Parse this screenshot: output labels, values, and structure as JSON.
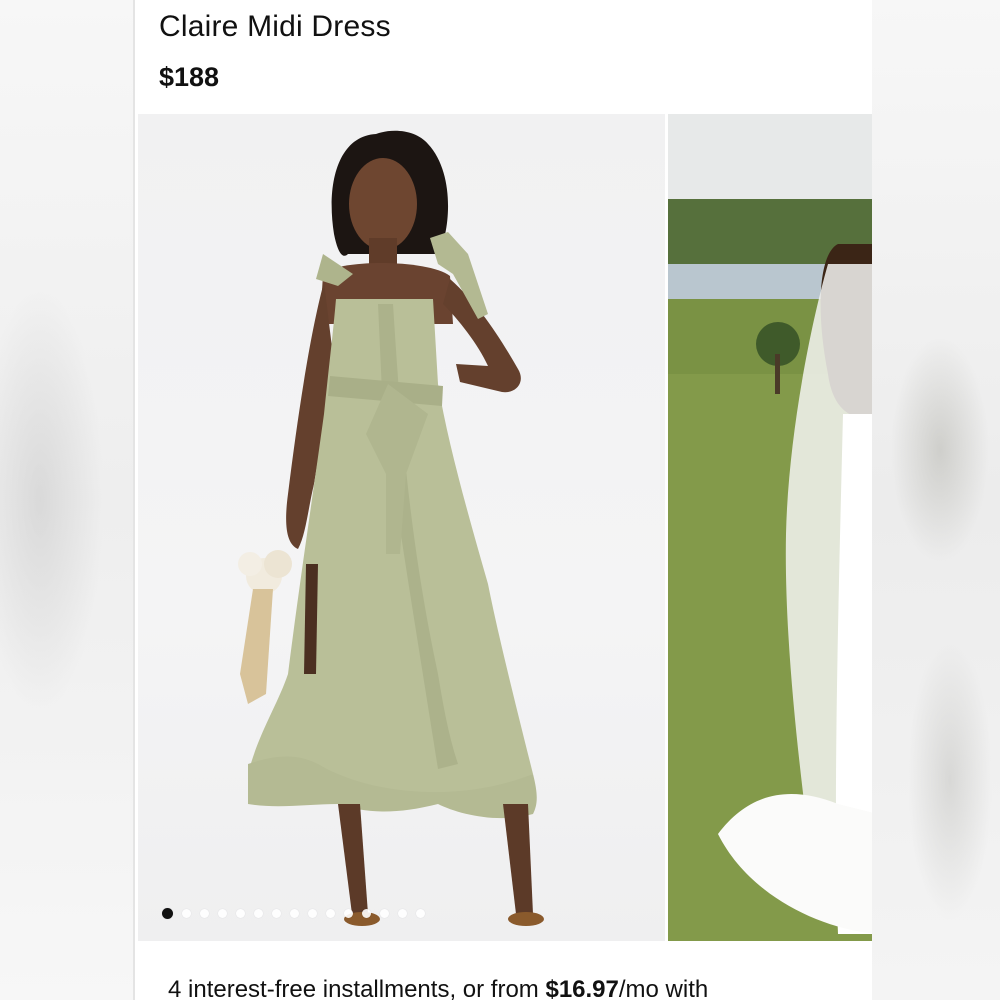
{
  "product": {
    "title": "Claire Midi Dress",
    "price": "$188"
  },
  "gallery": {
    "images": [
      {
        "alt": "model-in-sage-satin-midi-dress"
      },
      {
        "alt": "bride-with-veil-on-lawn"
      }
    ],
    "dot_count": 15,
    "active_index": 0,
    "colors": {
      "dress": "#b9bf98",
      "skin": "#6e4630",
      "grass": "#7a9244"
    }
  },
  "payment": {
    "text_before": "4 interest-free installments, or from ",
    "amount": "$16.97",
    "text_after": "/mo with"
  }
}
